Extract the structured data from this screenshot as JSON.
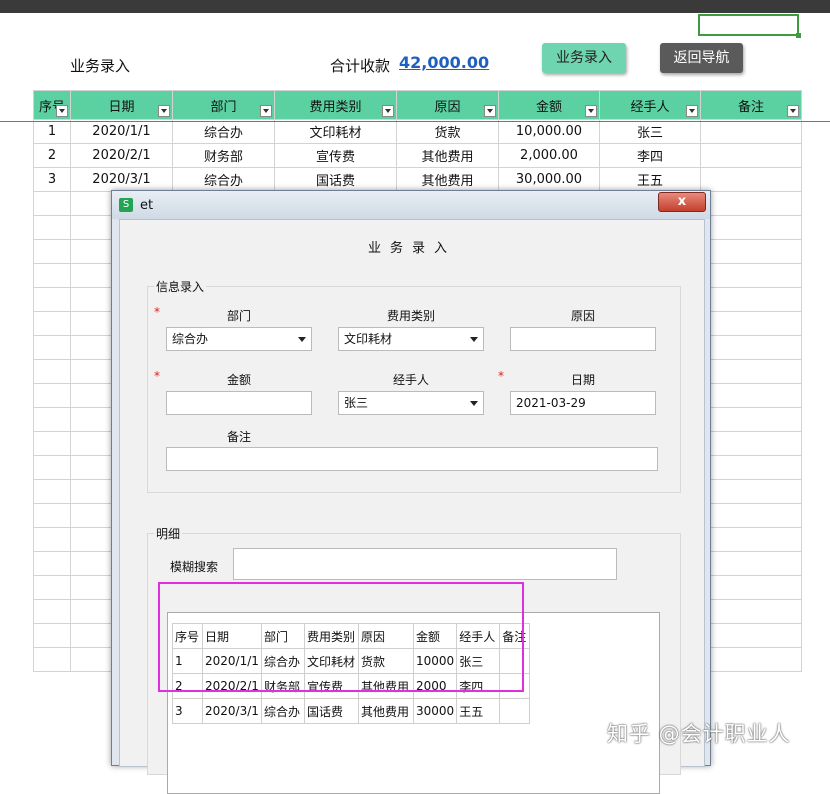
{
  "header": {
    "title": "业务录入",
    "total_label": "合计收款",
    "total_value": "42,000.00",
    "entry_button": "业务录入",
    "back_button": "返回导航"
  },
  "sheet": {
    "columns": [
      "序号",
      "日期",
      "部门",
      "费用类别",
      "原因",
      "金额",
      "经手人",
      "备注"
    ],
    "rows": [
      [
        "1",
        "2020/1/1",
        "综合办",
        "文印耗材",
        "货款",
        "10,000.00",
        "张三",
        ""
      ],
      [
        "2",
        "2020/2/1",
        "财务部",
        "宣传费",
        "其他费用",
        "2,000.00",
        "李四",
        ""
      ],
      [
        "3",
        "2020/3/1",
        "综合办",
        "国话费",
        "其他费用",
        "30,000.00",
        "王五",
        ""
      ]
    ]
  },
  "dialog": {
    "window_title": "et",
    "close_symbol": "x",
    "heading": "业务录入",
    "info_group": "信息录入",
    "labels": {
      "dept": "部门",
      "category": "费用类别",
      "reason": "原因",
      "amount": "金额",
      "handler": "经手人",
      "date": "日期",
      "note": "备注"
    },
    "required_mark": "*",
    "values": {
      "dept": "综合办",
      "category": "文印耗材",
      "reason": "",
      "amount": "",
      "handler": "张三",
      "date": "2021-03-29",
      "note": ""
    },
    "detail_group": "明细",
    "search_label": "模糊搜索",
    "search_value": "",
    "detail_columns": [
      "序号",
      "日期",
      "部门",
      "费用类别",
      "原因",
      "金额",
      "经手人",
      "备注"
    ],
    "detail_rows": [
      [
        "1",
        "2020/1/1",
        "综合办",
        "文印耗材",
        "货款",
        "10000",
        "张三",
        ""
      ],
      [
        "2",
        "2020/2/1",
        "财务部",
        "宣传费",
        "其他费用",
        "2000",
        "李四",
        ""
      ],
      [
        "3",
        "2020/3/1",
        "综合办",
        "国话费",
        "其他费用",
        "30000",
        "王五",
        ""
      ]
    ]
  },
  "watermark": "知乎 @会计职业人",
  "colors": {
    "header_green": "#5bd1a2",
    "button_green": "#6fd4b0",
    "link_blue": "#1f5fbf",
    "annotation_magenta": "#e02fe0",
    "required_red": "#d22222"
  }
}
